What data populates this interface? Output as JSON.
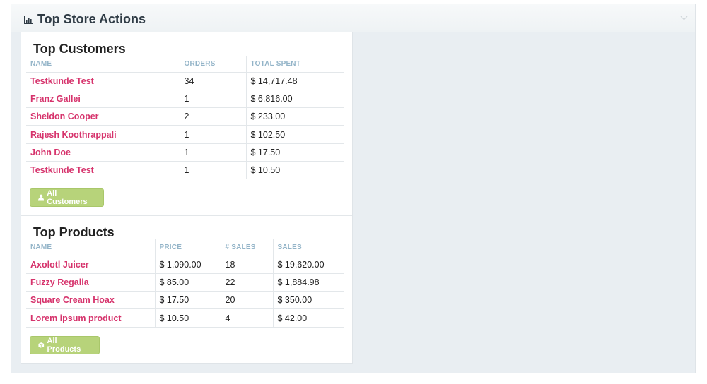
{
  "panel": {
    "title": "Top Store Actions",
    "title_icon": "bar-chart-icon",
    "collapse_icon": "chevron-down-icon"
  },
  "customers": {
    "title": "Top Customers",
    "columns": [
      "NAME",
      "ORDERS",
      "TOTAL SPENT"
    ],
    "rows": [
      [
        "Testkunde Test",
        "34",
        "$ 14,717.48"
      ],
      [
        "Franz Gallei",
        "1",
        "$ 6,816.00"
      ],
      [
        "Sheldon Cooper",
        "2",
        "$ 233.00"
      ],
      [
        "Rajesh Koothrappali",
        "1",
        "$ 102.50"
      ],
      [
        "John Doe",
        "1",
        "$ 17.50"
      ],
      [
        "Testkunde Test",
        "1",
        "$ 10.50"
      ]
    ],
    "button": {
      "label": "All Customers",
      "icon": "user-icon"
    }
  },
  "products": {
    "title": "Top Products",
    "columns": [
      "NAME",
      "PRICE",
      "# SALES",
      "SALES"
    ],
    "rows": [
      [
        "Axolotl Juicer",
        "$ 1,090.00",
        "18",
        "$ 19,620.00"
      ],
      [
        "Fuzzy Regalia",
        "$ 85.00",
        "22",
        "$ 1,884.98"
      ],
      [
        "Square Cream Hoax",
        "$ 17.50",
        "20",
        "$ 350.00"
      ],
      [
        "Lorem ipsum product",
        "$ 10.50",
        "4",
        "$ 42.00"
      ]
    ],
    "button": {
      "label": "All Products",
      "icon": "cube-icon"
    }
  },
  "colors": {
    "link": "#d6336c",
    "button": "#b7d37a",
    "header_text": "#93b4c8"
  }
}
